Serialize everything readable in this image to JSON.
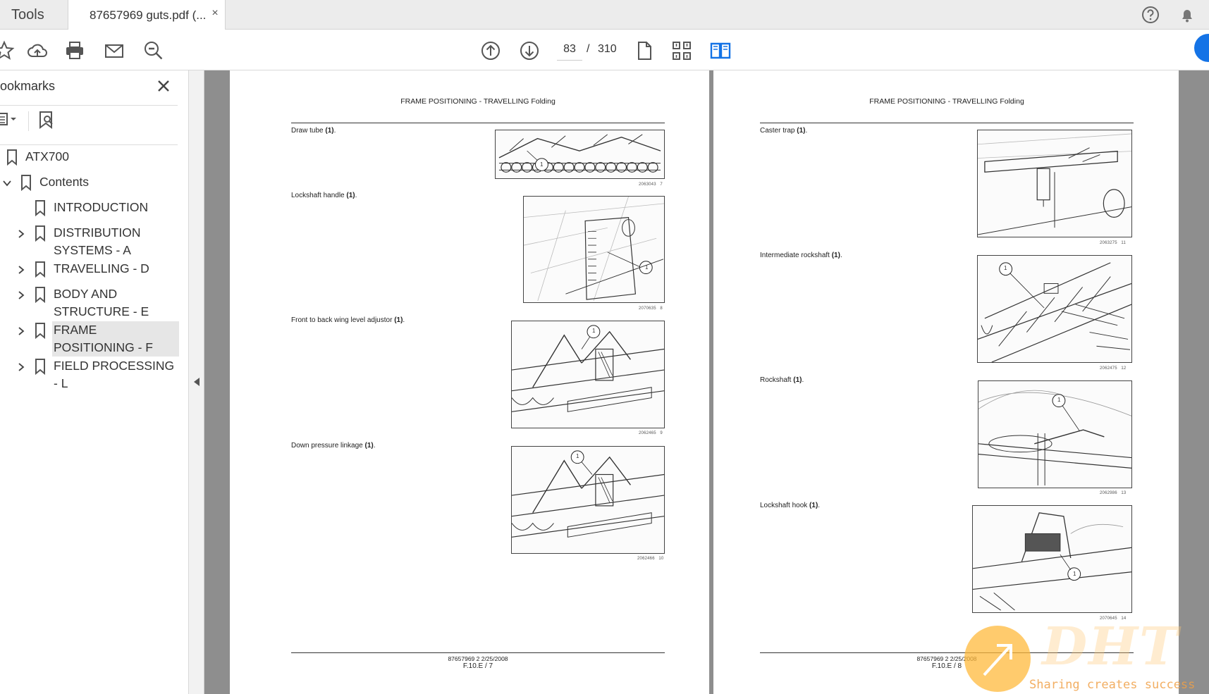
{
  "tabs": {
    "tools_label": "Tools",
    "document_tab_label": "87657969 guts.pdf (...",
    "close_glyph": "×"
  },
  "toolbar": {
    "current_page": "83",
    "page_separator": "/",
    "total_pages": "310"
  },
  "bookmarks_panel": {
    "title": "ookmarks",
    "items": [
      {
        "label": "ATX700",
        "expandable": false,
        "expanded": false
      },
      {
        "label": "Contents",
        "expandable": true,
        "expanded": true
      },
      {
        "label": "INTRODUCTION",
        "expandable": false,
        "expanded": false
      },
      {
        "label": "DISTRIBUTION SYSTEMS - A",
        "expandable": true,
        "expanded": false
      },
      {
        "label": "TRAVELLING - D",
        "expandable": true,
        "expanded": false
      },
      {
        "label": "BODY AND STRUCTURE - E",
        "expandable": true,
        "expanded": false
      },
      {
        "label": "FRAME POSITIONING - F",
        "expandable": true,
        "expanded": false,
        "selected": true
      },
      {
        "label": "FIELD PROCESSING - L",
        "expandable": true,
        "expanded": false
      }
    ]
  },
  "document": {
    "left_page": {
      "header": "FRAME POSITIONING - TRAVELLING Folding",
      "figures": [
        {
          "caption": "Draw tube",
          "callout": "(1)",
          "fig_id": "2063043",
          "fig_num": "7",
          "label": "1"
        },
        {
          "caption": "Lockshaft handle",
          "callout": "(1)",
          "fig_id": "2070635",
          "fig_num": "8",
          "label": "1"
        },
        {
          "caption": "Front to back wing level adjustor",
          "callout": "(1)",
          "fig_id": "2062465",
          "fig_num": "9",
          "label": "1"
        },
        {
          "caption": "Down pressure linkage",
          "callout": "(1)",
          "fig_id": "2062466",
          "fig_num": "10",
          "label": "1"
        }
      ],
      "footer_line1": "87657969 2 2/25/2008",
      "footer_line2": "F.10.E / 7"
    },
    "right_page": {
      "header": "FRAME POSITIONING - TRAVELLING Folding",
      "figures": [
        {
          "caption": "Caster trap",
          "callout": "(1)",
          "fig_id": "2063275",
          "fig_num": "11",
          "label": ""
        },
        {
          "caption": "Intermediate rockshaft",
          "callout": "(1)",
          "fig_id": "2062475",
          "fig_num": "12",
          "label": "1"
        },
        {
          "caption": "Rockshaft",
          "callout": "(1)",
          "fig_id": "2062986",
          "fig_num": "13",
          "label": "1"
        },
        {
          "caption": "Lockshaft hook",
          "callout": "(1)",
          "fig_id": "2070645",
          "fig_num": "14",
          "label": "1"
        }
      ],
      "footer_line1": "87657969 2 2/25/2008",
      "footer_line2": "F.10.E / 8"
    }
  },
  "watermark": {
    "brand": "DHT",
    "tagline": "Sharing creates success"
  },
  "colors": {
    "accent_blue": "#1473e6",
    "canvas_gray": "#8e8e8e",
    "selection_gray": "#e6e6e6"
  }
}
